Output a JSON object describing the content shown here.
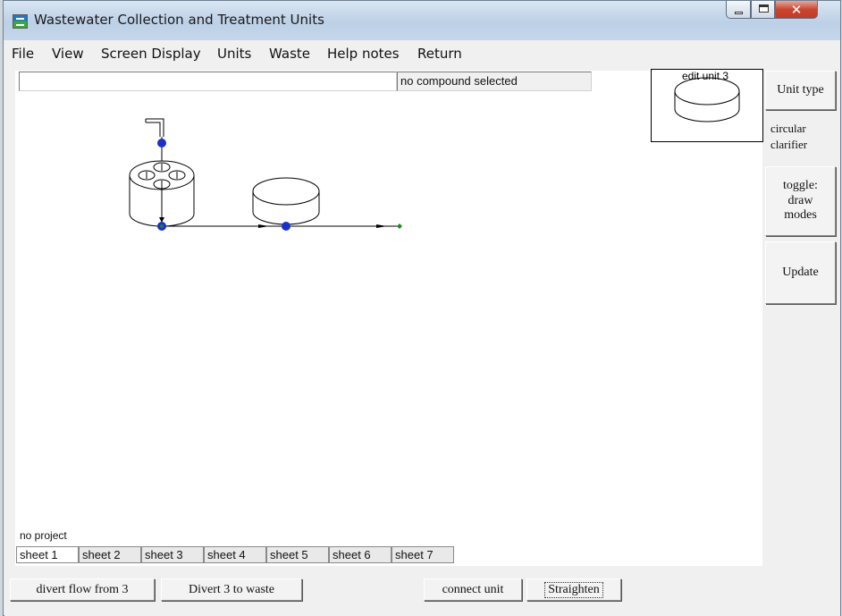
{
  "window": {
    "title": "Wastewater Collection and Treatment Units"
  },
  "menu": [
    "File",
    "View",
    "Screen Display",
    "Units",
    "Waste",
    "Help notes",
    "Return"
  ],
  "fields": {
    "name_value": "",
    "compound": "no compound selected"
  },
  "preview": {
    "label": "edit unit 3"
  },
  "side_panel": {
    "unit_type_label": "Unit type",
    "unit_kind": "circular clarifier",
    "toggle_label": "toggle: draw modes",
    "update_label": "Update"
  },
  "status": {
    "project": "no project"
  },
  "sheets": [
    "sheet 1",
    "sheet 2",
    "sheet 3",
    "sheet 4",
    "sheet 5",
    "sheet 6",
    "sheet 7"
  ],
  "active_sheet": "sheet 1",
  "bottom_buttons": {
    "divert_flow": "divert flow from  3",
    "divert_waste": "Divert 3 to waste",
    "connect_unit": "connect unit",
    "straighten": "Straighten"
  },
  "icons": {
    "app": "app-icon",
    "minimize": "minimize-icon",
    "maximize": "maximize-icon",
    "close": "close-icon"
  },
  "colors": {
    "node_blue": "#1a2fd0",
    "node_green": "#1e8a1e",
    "close_red": "#c9452f"
  }
}
